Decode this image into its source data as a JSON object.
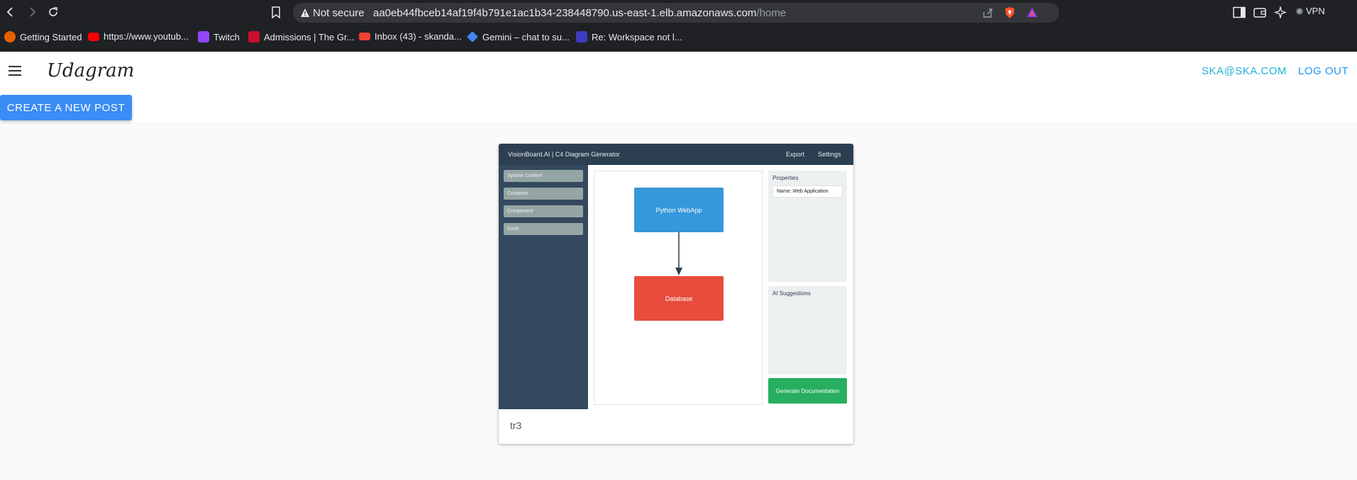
{
  "browser": {
    "not_secure_label": "Not secure",
    "url_host": "aa0eb44fbceb14af19f4b791e1ac1b34-238448790.us-east-1.elb.amazonaws.com",
    "url_path": "/home",
    "vpn_label": "VPN",
    "bookmarks": [
      {
        "label": "Getting Started",
        "icon": "firefox-icon",
        "color": "#e66000"
      },
      {
        "label": "https://www.youtub...",
        "icon": "youtube-icon",
        "color": "#ff0000"
      },
      {
        "label": "Twitch",
        "icon": "twitch-icon",
        "color": "#9146ff"
      },
      {
        "label": "Admissions | The Gr...",
        "icon": "admissions-icon",
        "color": "#c8102e"
      },
      {
        "label": "Inbox (43) - skanda...",
        "icon": "gmail-icon",
        "color": "#ea4335"
      },
      {
        "label": "Gemini – chat to su...",
        "icon": "gemini-icon",
        "color": "#4285f4"
      },
      {
        "label": "Re: Workspace not l...",
        "icon": "workspace-icon",
        "color": "#3b3dbf"
      }
    ]
  },
  "app": {
    "brand": "Udagram",
    "user_email": "SKA@SKA.COM",
    "logout_label": "LOG OUT",
    "create_post_label": "CREATE A NEW POST",
    "accent_color": "#2196f3"
  },
  "post": {
    "caption": "tr3",
    "image": {
      "app_title": "VisionBoard.AI | C4 Diagram Generator",
      "top_links": [
        "Export",
        "Settings"
      ],
      "sidebar_items": [
        "System Context",
        "Container",
        "Component",
        "Code"
      ],
      "nodes": [
        {
          "label": "Python WebApp",
          "color": "#3498db"
        },
        {
          "label": "Database",
          "color": "#e74c3c"
        }
      ],
      "properties_title": "Properties",
      "properties_field": "Name: Web Application",
      "ai_title": "AI Suggestions",
      "generate_label": "Generate Documentation"
    }
  }
}
